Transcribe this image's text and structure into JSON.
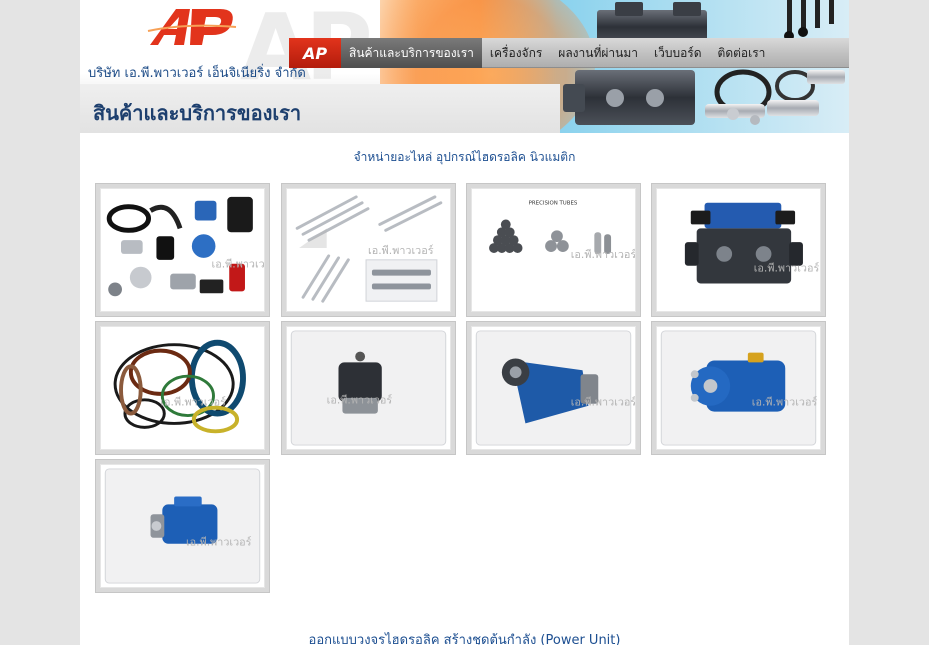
{
  "header": {
    "company_name": "บริษัท เอ.พี.พาวเวอร์ เอ็นจิเนียริ่ง จำกัด",
    "page_heading": "สินค้าและบริการของเรา",
    "logo_text": "AP",
    "colors": {
      "brand_red": "#e2341c",
      "heading_blue": "#1d3f6e"
    }
  },
  "nav": {
    "items": [
      {
        "label": "สินค้าและบริการของเรา",
        "active": true
      },
      {
        "label": "เครื่องจักร",
        "active": false
      },
      {
        "label": "ผลงานที่ผ่านมา",
        "active": false
      },
      {
        "label": "เว็บบอร์ด",
        "active": false
      },
      {
        "label": "ติดต่อเรา",
        "active": false
      }
    ]
  },
  "main": {
    "section_subtitle": "จำหน่ายอะไหล่ อุปกรณ์ไฮดรอลิค นิวแมติก",
    "section2_title": "ออกแบบวงจรไฮดรอลิค สร้างชุดต้นกำลัง (Power Unit)",
    "watermark_text": "เอ.พี.พาวเวอร์",
    "thumbnails": [
      {
        "name": "hydraulic-fittings-and-filters",
        "icon": "fittings-collage-icon"
      },
      {
        "name": "chrome-rods-and-shafts",
        "icon": "rods-icon"
      },
      {
        "name": "precision-tubes",
        "icon": "tubes-icon",
        "caption": "PRECISION TUBES"
      },
      {
        "name": "directional-valve",
        "icon": "valve-icon"
      },
      {
        "name": "seals-and-orings",
        "icon": "seals-icon"
      },
      {
        "name": "gear-pump",
        "icon": "gear-pump-icon"
      },
      {
        "name": "piston-pump",
        "icon": "piston-pump-icon"
      },
      {
        "name": "blue-hydraulic-motor",
        "icon": "hydraulic-motor-icon"
      },
      {
        "name": "vane-pump",
        "icon": "vane-pump-icon"
      }
    ]
  }
}
